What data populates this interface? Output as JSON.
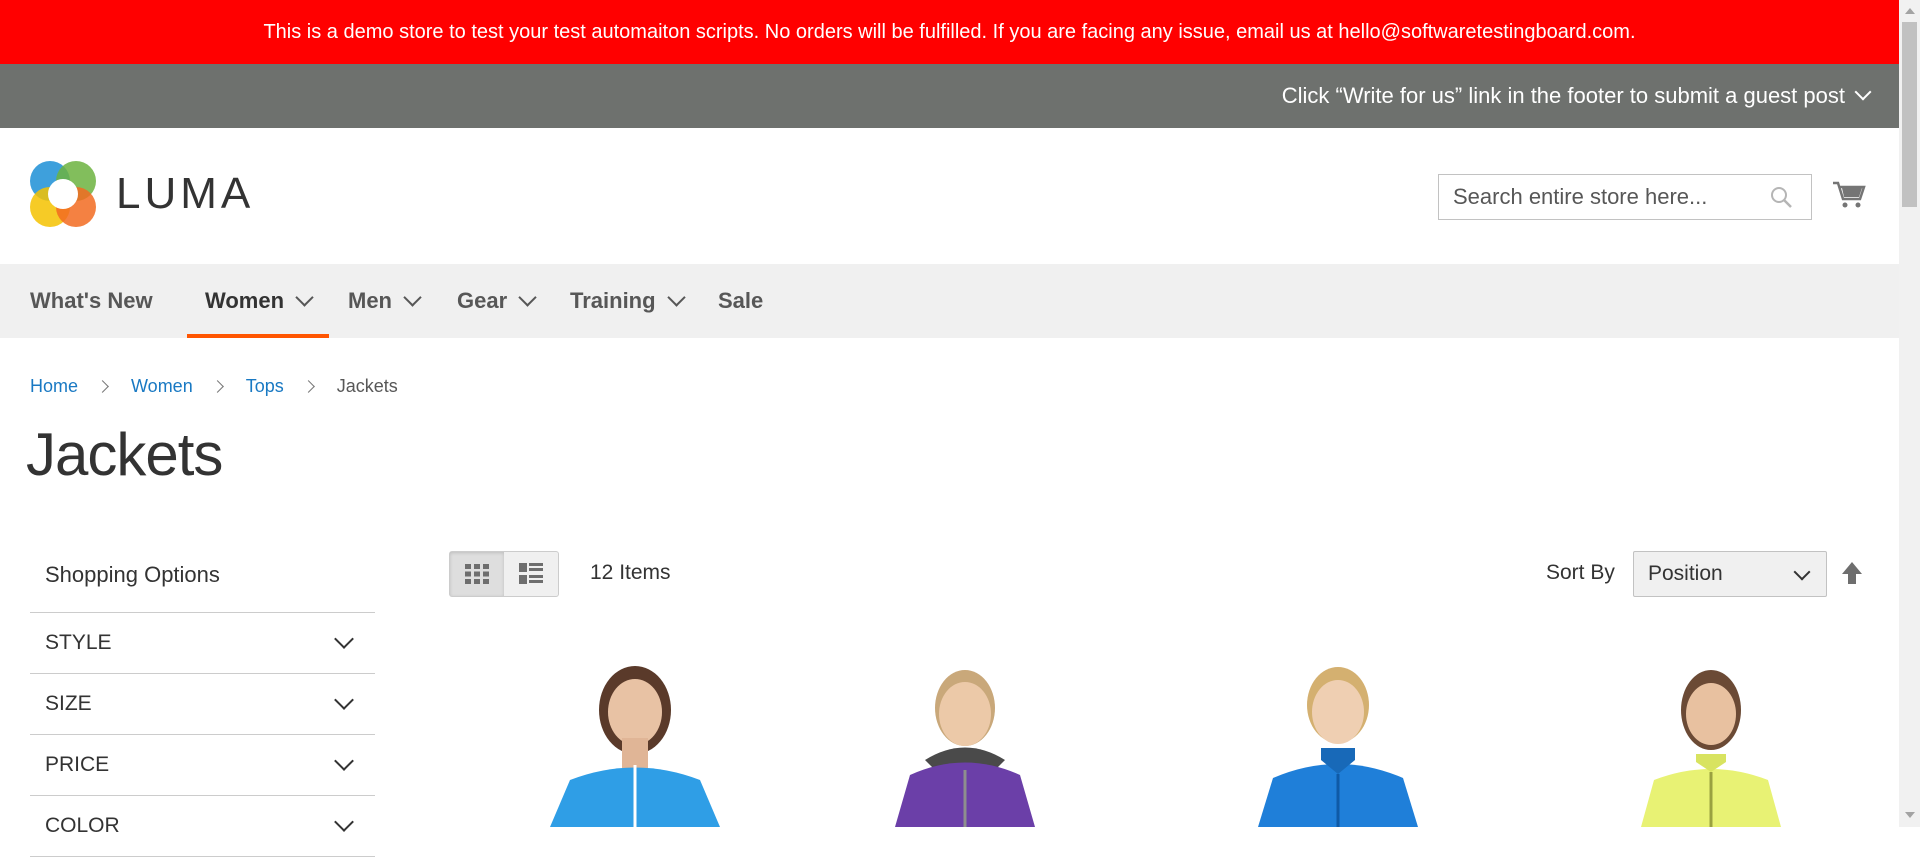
{
  "demo_notice": "This is a demo store to test your test automaiton scripts. No orders will be fulfilled. If you are facing any issue, email us at hello@softwaretestingboard.com.",
  "promo": "Click “Write for us” link in the footer to submit a guest post",
  "logo_text": "LUMA",
  "search": {
    "placeholder": "Search entire store here..."
  },
  "nav": [
    {
      "label": "What's New"
    },
    {
      "label": "Women"
    },
    {
      "label": "Men"
    },
    {
      "label": "Gear"
    },
    {
      "label": "Training"
    },
    {
      "label": "Sale"
    }
  ],
  "breadcrumb": {
    "home": "Home",
    "women": "Women",
    "tops": "Tops",
    "current": "Jackets"
  },
  "page_title": "Jackets",
  "sidebar": {
    "title": "Shopping Options",
    "filters": [
      "STYLE",
      "SIZE",
      "PRICE",
      "COLOR"
    ]
  },
  "toolbar": {
    "items_count": "12 Items",
    "sort_label": "Sort By",
    "sort_value": "Position"
  },
  "products": [
    {
      "name": "jacket-light-blue",
      "color": "#2f9ee6"
    },
    {
      "name": "jacket-purple",
      "color": "#6b3fa8"
    },
    {
      "name": "jacket-blue",
      "color": "#1f7fd9"
    },
    {
      "name": "jacket-yellow",
      "color": "#e8f274"
    }
  ],
  "colors": {
    "demo_bar": "#ff0000",
    "promo_bar": "#6e716e",
    "nav_bg": "#f0f0f0",
    "accent": "#ff5501",
    "link": "#1979c3"
  }
}
